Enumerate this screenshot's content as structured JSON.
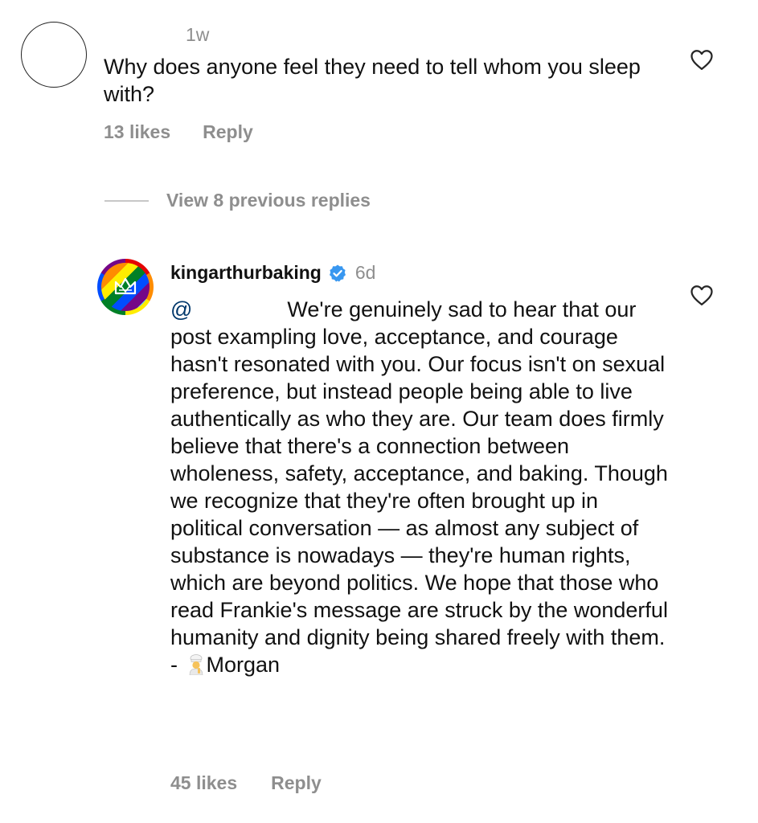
{
  "comment": {
    "time": "1w",
    "text": "Why does anyone feel they need to tell whom you sleep with?",
    "likes": "13 likes",
    "reply_label": "Reply"
  },
  "thread": {
    "view_previous": "View 8 previous replies"
  },
  "reply": {
    "username": "kingarthurbaking",
    "verified": true,
    "time": "6d",
    "mention": "@",
    "text": "We're genuinely sad to hear that our post exampling love, acceptance, and courage hasn't resonated with you. Our focus isn't on sexual preference, but instead people being able to live authentically as who they are. Our team does firmly believe that there's a connection between wholeness, safety, acceptance, and baking. Though we recognize that they're often brought up in political conversation — as almost any subject of substance is nowadays — they're human rights, which are beyond politics. We hope that those who read Frankie's message are struck by the wonderful humanity and dignity being shared freely with them. -",
    "signature": "Morgan",
    "signature_emoji": "cook-emoji",
    "likes": "45 likes",
    "reply_label": "Reply"
  },
  "icons": {
    "like": "heart-icon",
    "verified": "verified-badge-icon"
  },
  "colors": {
    "meta_gray": "#8e8e8e",
    "verified_blue": "#3897f0",
    "mention_blue": "#00376b"
  }
}
